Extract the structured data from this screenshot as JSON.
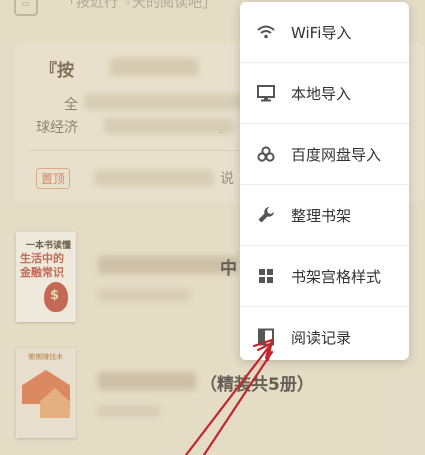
{
  "header": {
    "title": "「按近行『天的阅读吧」",
    "icon": "book-icon"
  },
  "banner": {
    "title": "『按",
    "line1": "全",
    "line1_tail": "近1",
    "line2": "球经济",
    "line2_tail": "。",
    "pin_label": "置顶",
    "tail": "说"
  },
  "books": [
    {
      "cover_title_1": "一本书读懂",
      "cover_title_2": "生活中的",
      "cover_title_3": "金融常识",
      "title_tail": "中"
    },
    {
      "cover_title": "懒懒赚钱术",
      "title_tail": "（精装共5册）"
    }
  ],
  "menu": {
    "items": [
      {
        "label": "WiFi导入",
        "icon": "wifi-icon"
      },
      {
        "label": "本地导入",
        "icon": "monitor-icon"
      },
      {
        "label": "百度网盘导入",
        "icon": "cloud-icon"
      },
      {
        "label": "整理书架",
        "icon": "wrench-icon"
      },
      {
        "label": "书架宫格样式",
        "icon": "grid-icon"
      },
      {
        "label": "阅读记录",
        "icon": "book-record-icon"
      }
    ]
  },
  "colors": {
    "background": "#f1ead6",
    "menu_background": "#ffffff",
    "arrow": "#c0272d",
    "pin_badge": "#d76a43"
  }
}
